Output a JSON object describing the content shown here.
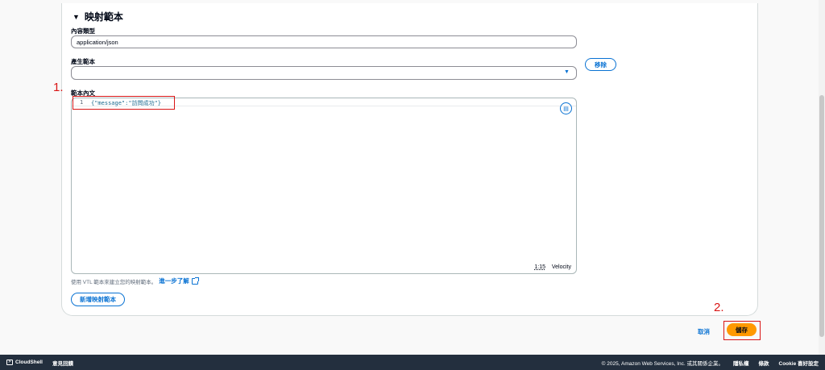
{
  "section": {
    "title": "映射範本"
  },
  "content_type": {
    "label": "內容類型",
    "value": "application/json"
  },
  "generate_template": {
    "label": "產生範本",
    "value": "",
    "remove_label": "移除"
  },
  "template_body": {
    "label": "範本內文",
    "line_number": "1",
    "code": "{\"message\":\"訪問成功\"}",
    "cursor_position": "1:15",
    "language": "Velocity"
  },
  "hint": {
    "text": "使用 VTL 範本來建立您的映射範本。",
    "link": "進一步了解"
  },
  "add_template_label": "新增映射範本",
  "annotations": {
    "first": "1.",
    "second": "2.",
    "color": "#d91515"
  },
  "actions": {
    "cancel": "取消",
    "save": "儲存"
  },
  "footer": {
    "cloudshell": "CloudShell",
    "feedback": "意見回饋",
    "copyright": "© 2025, Amazon Web Services, Inc. 或其關係企業。",
    "privacy": "隱私權",
    "terms": "條款",
    "cookie": "Cookie 喜好設定"
  },
  "colors": {
    "accent": "#0972d3",
    "primary_button": "#ff9900",
    "footer_bg": "#232f3e"
  }
}
